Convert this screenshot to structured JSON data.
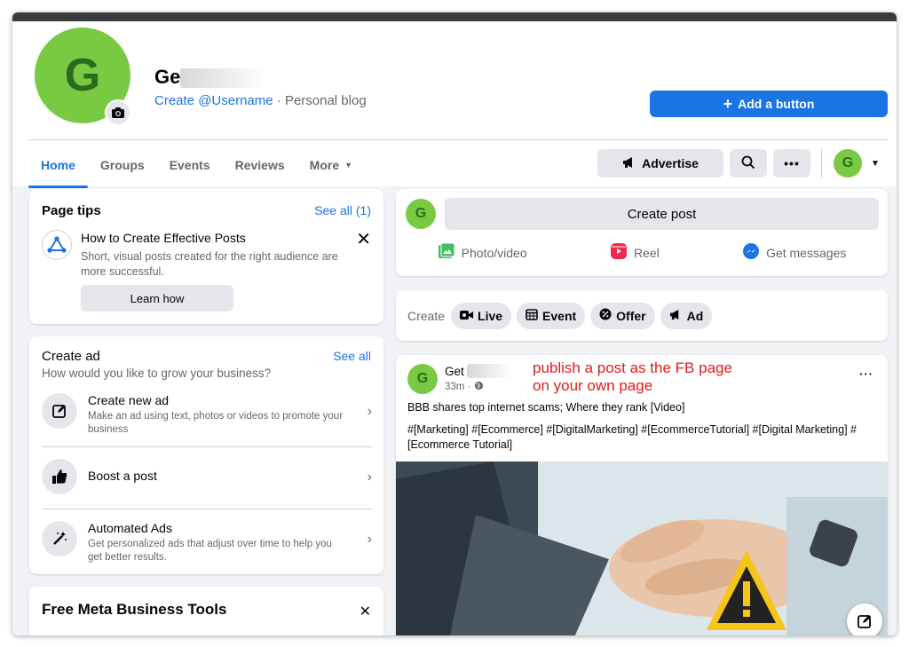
{
  "header": {
    "avatar_letter": "G",
    "page_name": "Ge",
    "create_username": "Create @Username",
    "page_category": " · Personal blog",
    "add_button_label": "Add a button"
  },
  "tabs": [
    {
      "label": "Home"
    },
    {
      "label": "Groups"
    },
    {
      "label": "Events"
    },
    {
      "label": "Reviews"
    },
    {
      "label": "More"
    }
  ],
  "toolbar": {
    "advertise_label": "Advertise",
    "avatar_letter": "G"
  },
  "page_tips": {
    "title": "Page tips",
    "see_all": "See all (1)",
    "tip_title": "How to Create Effective Posts",
    "tip_desc": "Short, visual posts created for the right audience are more successful.",
    "learn_button": "Learn how"
  },
  "create_ad": {
    "title": "Create ad",
    "see_all": "See all",
    "subtitle": "How would you like to grow your business?",
    "items": [
      {
        "title": "Create new ad",
        "desc": "Make an ad using text, photos or videos to promote your business"
      },
      {
        "title": "Boost a post",
        "desc": ""
      },
      {
        "title": "Automated Ads",
        "desc": "Get personalized ads that adjust over time to help you get better results."
      }
    ]
  },
  "tools": {
    "title": "Free Meta Business Tools"
  },
  "composer": {
    "avatar_letter": "G",
    "create_post": "Create post",
    "actions": [
      {
        "label": "Photo/video"
      },
      {
        "label": "Reel"
      },
      {
        "label": "Get messages"
      }
    ]
  },
  "create_bar": {
    "label": "Create",
    "chips": [
      {
        "label": "Live"
      },
      {
        "label": "Event"
      },
      {
        "label": "Offer"
      },
      {
        "label": "Ad"
      }
    ]
  },
  "post": {
    "avatar_letter": "G",
    "author": "Get",
    "time": "33m · ",
    "headline": "BBB shares top internet scams; Where they rank [Video]",
    "hashtags": "#[Marketing] #[Ecommerce] #[DigitalMarketing] #[EcommerceTutorial] #[Digital Marketing] #[Ecommerce Tutorial]",
    "more_label": "···"
  },
  "annotation": {
    "line1": "publish a post as the FB page",
    "line2": "on your own page"
  },
  "colors": {
    "brand_blue": "#1b74e4",
    "avatar_green": "#7ac943",
    "annotation_red": "#e01b1b"
  }
}
